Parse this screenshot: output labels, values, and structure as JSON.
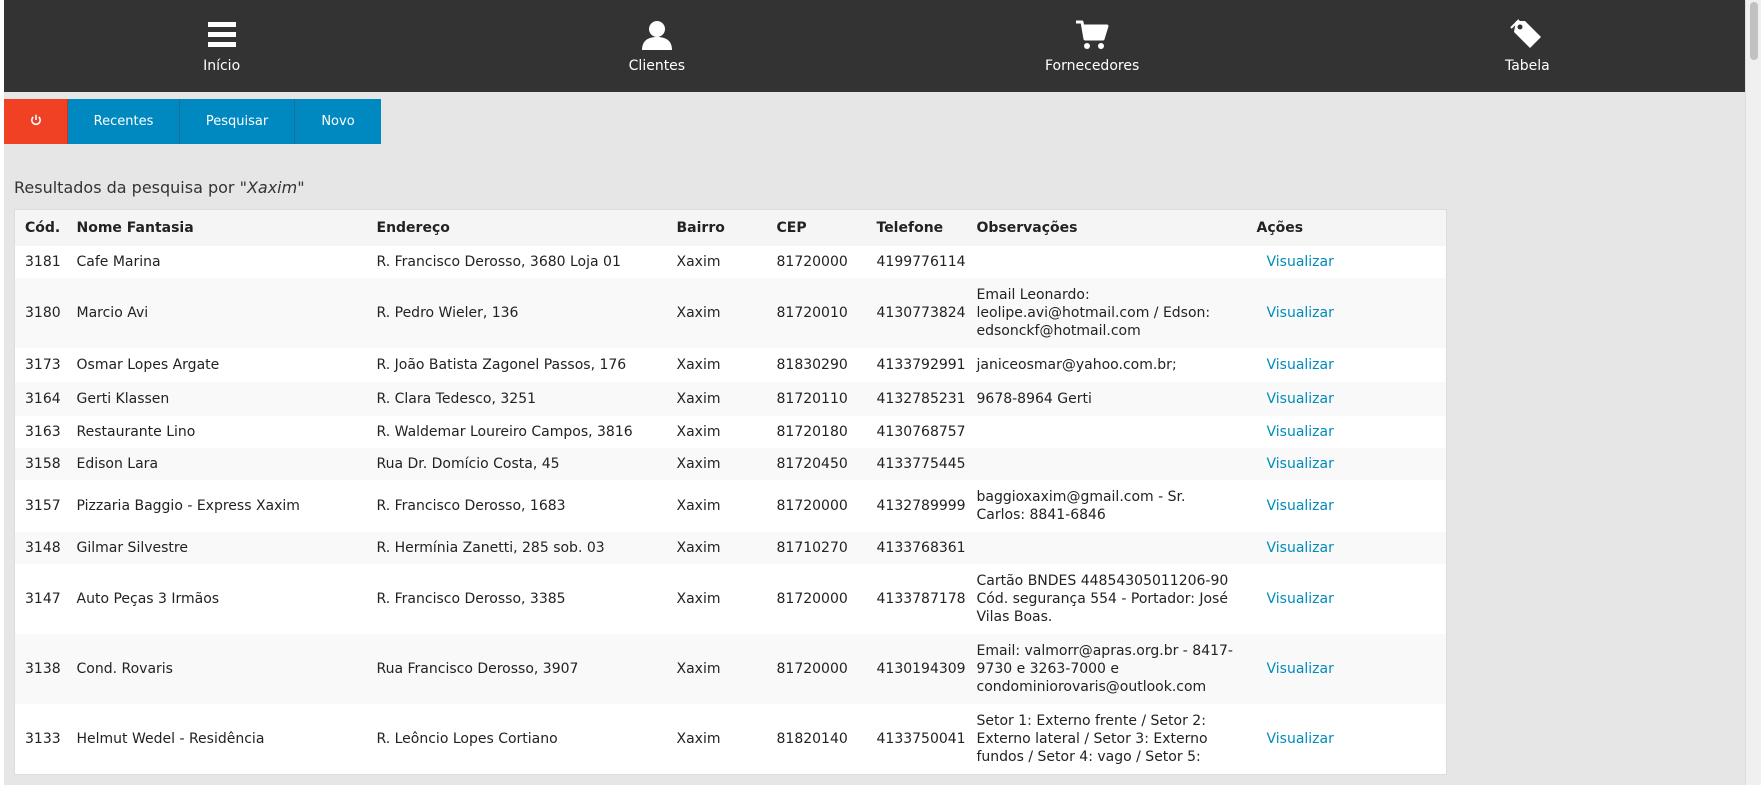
{
  "nav": {
    "items": [
      {
        "label": "Início",
        "icon": "menu-icon"
      },
      {
        "label": "Clientes",
        "icon": "user-icon"
      },
      {
        "label": "Fornecedores",
        "icon": "cart-icon"
      },
      {
        "label": "Tabela",
        "icon": "tag-icon"
      }
    ]
  },
  "toolbar": {
    "power_icon": "power-icon",
    "recentes": "Recentes",
    "pesquisar": "Pesquisar",
    "novo": "Novo"
  },
  "results": {
    "prefix": "Resultados da pesquisa por \"",
    "query": "Xaxim",
    "suffix": "\""
  },
  "table": {
    "headers": [
      "Cód.",
      "Nome Fantasia",
      "Endereço",
      "Bairro",
      "CEP",
      "Telefone",
      "Observações",
      "Ações"
    ],
    "action_label": "Visualizar",
    "rows": [
      {
        "cod": "3181",
        "nome": "Cafe Marina",
        "endereco": "R. Francisco Derosso, 3680 Loja 01",
        "bairro": "Xaxim",
        "cep": "81720000",
        "telefone": "4199776114",
        "obs": ""
      },
      {
        "cod": "3180",
        "nome": "Marcio Avi",
        "endereco": "R. Pedro Wieler, 136",
        "bairro": "Xaxim",
        "cep": "81720010",
        "telefone": "4130773824",
        "obs": "Email Leonardo: leolipe.avi@hotmail.com / Edson: edsonckf@hotmail.com"
      },
      {
        "cod": "3173",
        "nome": "Osmar Lopes Argate",
        "endereco": "R. João Batista Zagonel Passos, 176",
        "bairro": "Xaxim",
        "cep": "81830290",
        "telefone": "4133792991",
        "obs": "janiceosmar@yahoo.com.br;"
      },
      {
        "cod": "3164",
        "nome": "Gerti Klassen",
        "endereco": "R. Clara Tedesco, 3251",
        "bairro": "Xaxim",
        "cep": "81720110",
        "telefone": "4132785231",
        "obs": "9678-8964 Gerti"
      },
      {
        "cod": "3163",
        "nome": "Restaurante Lino",
        "endereco": "R. Waldemar Loureiro Campos, 3816",
        "bairro": "Xaxim",
        "cep": "81720180",
        "telefone": "4130768757",
        "obs": ""
      },
      {
        "cod": "3158",
        "nome": "Edison Lara",
        "endereco": "Rua Dr. Domício Costa, 45",
        "bairro": "Xaxim",
        "cep": "81720450",
        "telefone": "4133775445",
        "obs": ""
      },
      {
        "cod": "3157",
        "nome": "Pizzaria Baggio - Express Xaxim",
        "endereco": "R. Francisco Derosso, 1683",
        "bairro": "Xaxim",
        "cep": "81720000",
        "telefone": "4132789999",
        "obs": "baggioxaxim@gmail.com - Sr. Carlos: 8841-6846"
      },
      {
        "cod": "3148",
        "nome": "Gilmar Silvestre",
        "endereco": "R. Hermínia Zanetti, 285 sob. 03",
        "bairro": "Xaxim",
        "cep": "81710270",
        "telefone": "4133768361",
        "obs": ""
      },
      {
        "cod": "3147",
        "nome": "Auto Peças 3 Irmãos",
        "endereco": "R. Francisco Derosso, 3385",
        "bairro": "Xaxim",
        "cep": "81720000",
        "telefone": "4133787178",
        "obs": "Cartão BNDES 44854305011206-90 Cód. segurança 554 - Portador: José Vilas Boas."
      },
      {
        "cod": "3138",
        "nome": "Cond. Rovaris",
        "endereco": "Rua Francisco Derosso, 3907",
        "bairro": "Xaxim",
        "cep": "81720000",
        "telefone": "4130194309",
        "obs": "Email: valmorr@apras.org.br - 8417-9730 e 3263-7000 e condominiorovaris@outlook.com"
      },
      {
        "cod": "3133",
        "nome": "Helmut Wedel - Residência",
        "endereco": "R. Leôncio Lopes Cortiano",
        "bairro": "Xaxim",
        "cep": "81820140",
        "telefone": "4133750041",
        "obs": "Setor 1: Externo frente / Setor 2: Externo lateral / Setor 3: Externo fundos / Setor 4: vago / Setor 5:"
      }
    ]
  },
  "colors": {
    "nav_bg": "#333333",
    "toolbar_blue": "#0089c0",
    "power_red": "#f04124",
    "link": "#008cba"
  }
}
